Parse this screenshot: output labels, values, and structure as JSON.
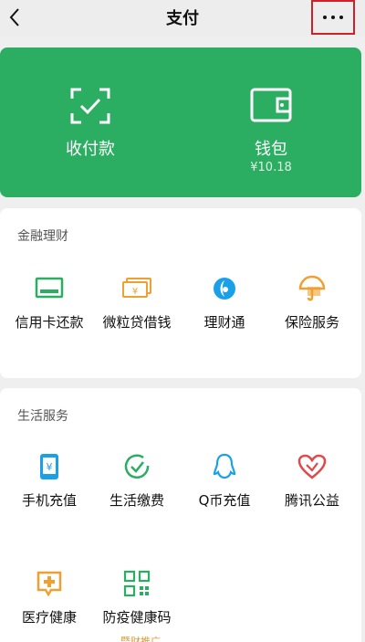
{
  "nav": {
    "title": "支付"
  },
  "wallet_card": {
    "collect_label": "收付款",
    "wallet_label": "钱包",
    "wallet_balance": "¥10.18"
  },
  "finance": {
    "title": "金融理财",
    "items": [
      {
        "label": "信用卡还款",
        "icon": "credit-card-icon"
      },
      {
        "label": "微粒贷借钱",
        "icon": "loan-bills-icon"
      },
      {
        "label": "理财通",
        "icon": "licaitong-icon"
      },
      {
        "label": "保险服务",
        "icon": "umbrella-icon"
      }
    ]
  },
  "life": {
    "title": "生活服务",
    "items": [
      {
        "label": "手机充值",
        "icon": "phone-yuan-icon"
      },
      {
        "label": "生活缴费",
        "icon": "check-leaf-icon"
      },
      {
        "label": "Q币充值",
        "icon": "qq-penguin-icon"
      },
      {
        "label": "腾讯公益",
        "icon": "heart-icon"
      },
      {
        "label": "医疗健康",
        "icon": "medical-plus-icon"
      },
      {
        "label": "防疫健康码",
        "icon": "qr-code-icon"
      }
    ]
  },
  "footer_partial_text": "暨财推广",
  "colors": {
    "green": "#2bad62",
    "accent_blue": "#1aa0e8",
    "accent_orange": "#f0a030",
    "accent_red": "#e0484a",
    "highlight_red": "#d0202a"
  }
}
